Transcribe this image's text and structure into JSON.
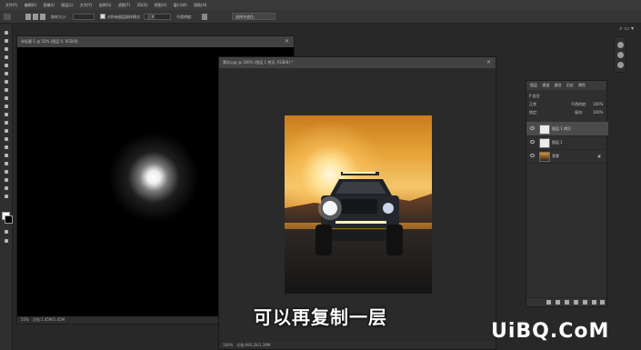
{
  "menu": [
    "文件(F)",
    "编辑(E)",
    "图像(I)",
    "图层(L)",
    "文字(Y)",
    "选择(S)",
    "滤镜(T)",
    "3D(D)",
    "视图(V)",
    "窗口(W)",
    "帮助(H)"
  ],
  "options": {
    "sample_size": "取样大小:",
    "sample_all": "对所有图层取样",
    "mode_label": "模式:",
    "mode_value": "正常",
    "opacity_label": "不透明度:",
    "select_subject": "选择并遮住..."
  },
  "doc1": {
    "title": "未标题-1 @ 50% (图层 0, RGB/8)",
    "zoom": "50%",
    "status": "文档:1.45M/1.45M"
  },
  "doc2": {
    "title": "素材.jpg @ 100% (图层 1 拷贝, RGB/8) *",
    "zoom": "100%",
    "status": "文档:695.2K/1.39M"
  },
  "subtitle": "可以再复制一层",
  "layers_panel": {
    "tabs": [
      "图层",
      "通道",
      "路径",
      "历史",
      "属性"
    ],
    "kind": "P 类型",
    "blend": "正常",
    "opacity_label": "不透明度:",
    "opacity_value": "100%",
    "lock_label": "锁定:",
    "fill_label": "填充:",
    "fill_value": "100%",
    "layers": [
      {
        "name": "图层 1 拷贝",
        "selected": true
      },
      {
        "name": "图层 1",
        "selected": false
      },
      {
        "name": "背景",
        "selected": false
      }
    ]
  },
  "watermark": "UiBQ.CoM",
  "colors": {
    "accent": "#4a4a4a",
    "selected_layer": "#4b4b4b"
  }
}
